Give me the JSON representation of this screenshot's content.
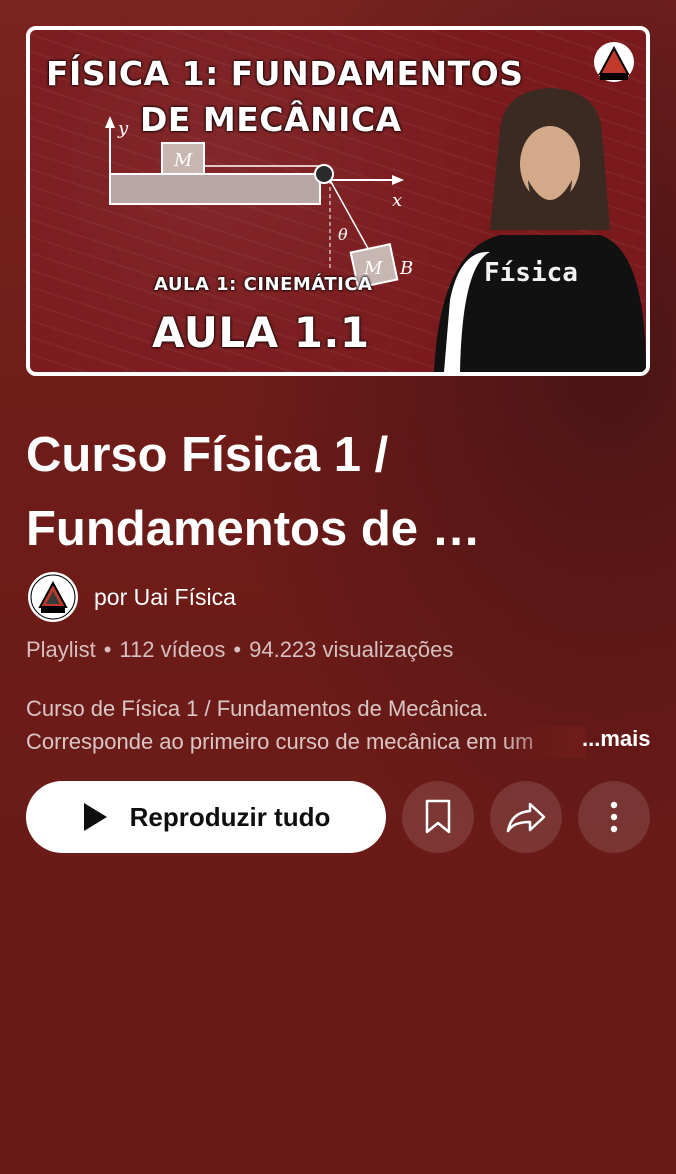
{
  "thumbnail": {
    "title_line1": "FÍSICA 1: FUNDAMENTOS",
    "title_line2": "DE MECÂNICA",
    "subtitle": "AULA 1: CINEMÁTICA",
    "lesson": "AULA 1.1",
    "shirt_text": "Física",
    "diagram_labels": {
      "y": "y",
      "x": "x",
      "m1": "M",
      "m2": "M",
      "b": "B",
      "theta": "θ"
    }
  },
  "playlist": {
    "title": "Curso Física 1 / Fundamentos de …",
    "author": "por Uai Física",
    "type": "Playlist",
    "video_count": "112 vídeos",
    "views": "94.223 visualizações",
    "description_line1": "Curso de Física 1 / Fundamentos de Mecânica.",
    "description_line2": "Corresponde ao primeiro curso de mecânica em um",
    "more_label": "...mais"
  },
  "actions": {
    "play_all_label": "Reproduzir tudo",
    "icons": [
      "play-icon",
      "bookmark-icon",
      "share-icon",
      "more-vert-icon"
    ]
  },
  "colors": {
    "background": "#6b1b18",
    "button_bg": "#ffffff",
    "text": "#ffffff"
  }
}
